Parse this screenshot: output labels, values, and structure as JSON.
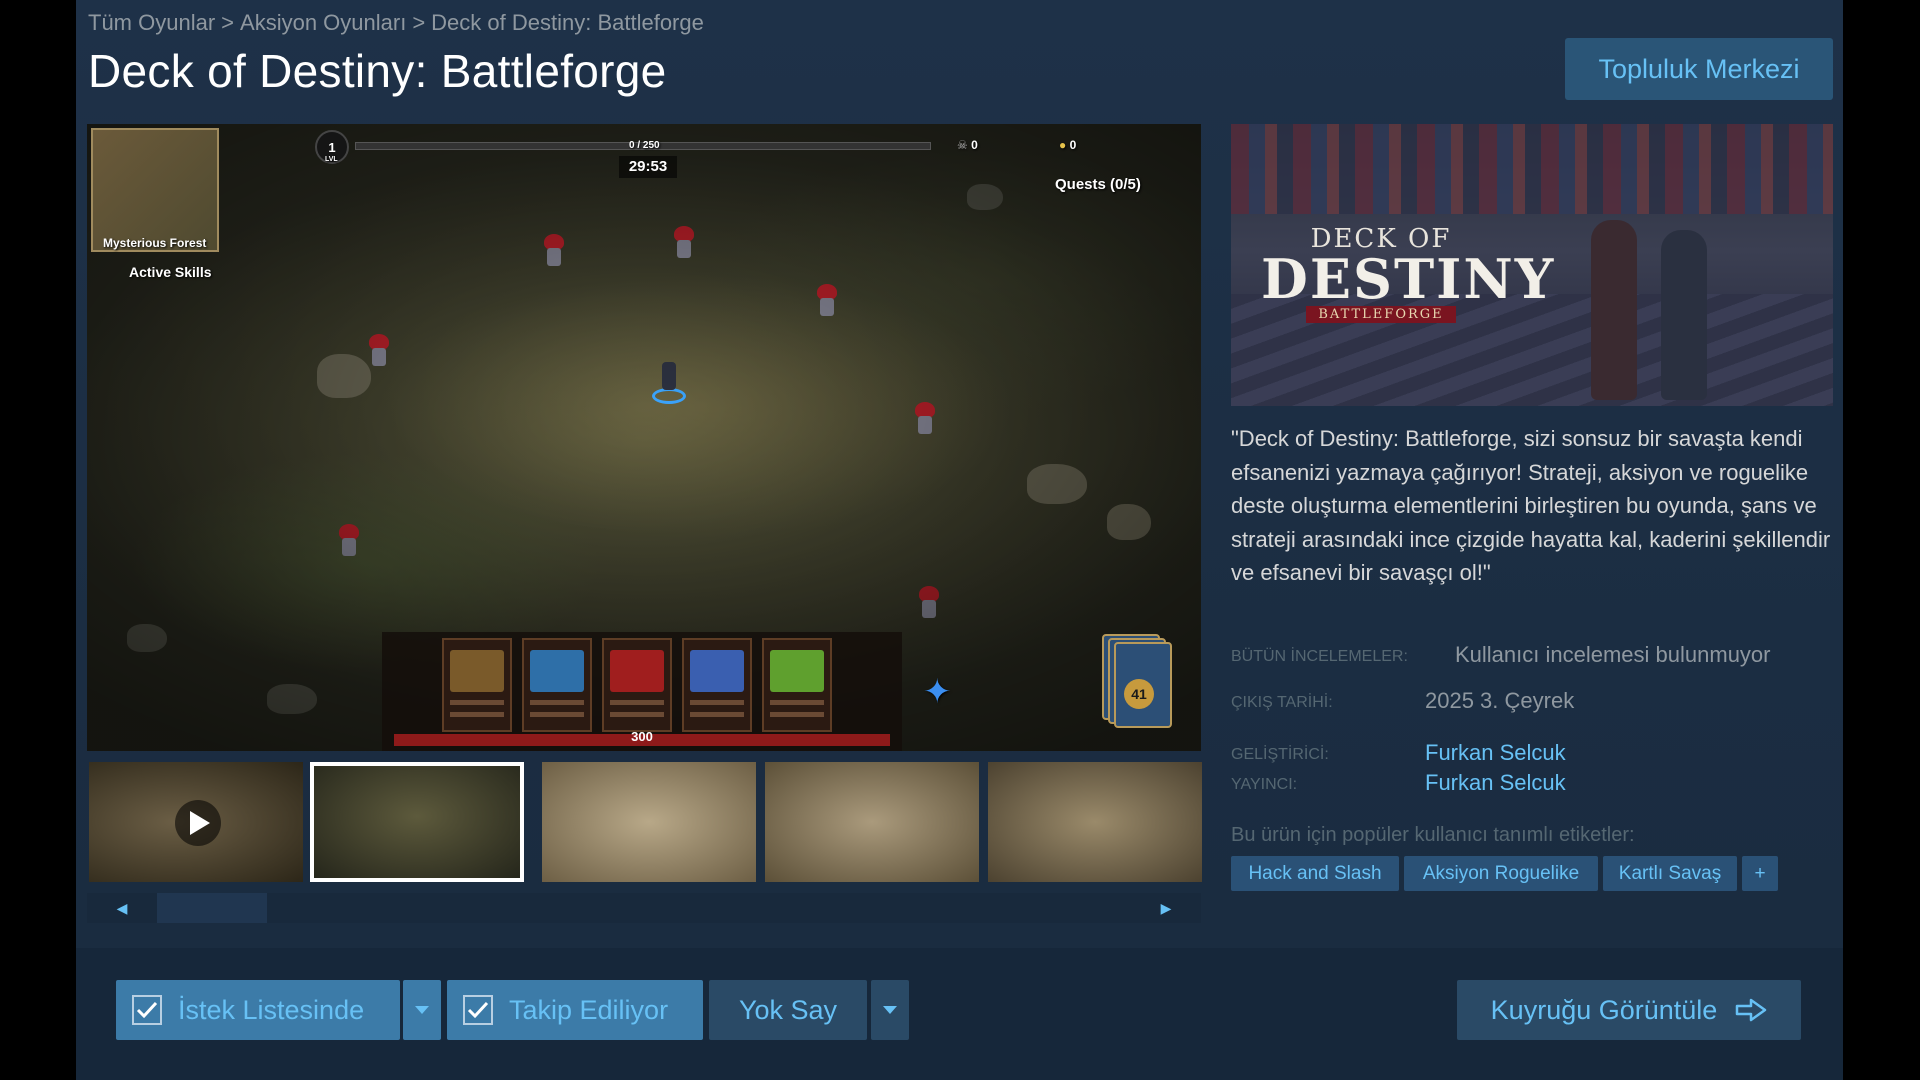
{
  "breadcrumb": {
    "items": [
      "Tüm Oyunlar",
      "Aksiyon Oyunları",
      "Deck of Destiny: Battleforge"
    ],
    "separator": ">"
  },
  "title": "Deck of Destiny: Battleforge",
  "community_button": "Topluluk Merkezi",
  "screenshot": {
    "minimap_label": "Mysterious Forest",
    "active_skills_label": "Active Skills",
    "level": "1",
    "level_sub": "LVL",
    "xp": "0 / 250",
    "timer": "29:53",
    "kills": "0",
    "gold": "0",
    "quests": "Quests (0/5)",
    "health": "300",
    "deck_count": "41",
    "colors": {
      "hp": "#8e1a1a",
      "ring": "#3ba5ff",
      "enemy_hat": "#c0202a"
    }
  },
  "capsule": {
    "logo_top": "DECK OF",
    "logo_main": "DESTINY",
    "logo_sub": "BATTLEFORGE"
  },
  "thumbnails": [
    {
      "type": "video",
      "selected": false
    },
    {
      "type": "image",
      "selected": true
    },
    {
      "type": "image",
      "selected": false
    },
    {
      "type": "image",
      "selected": false
    },
    {
      "type": "image",
      "selected": false
    }
  ],
  "slider": {
    "left_arrow": "◀",
    "right_arrow": "▶"
  },
  "description": "\"Deck of Destiny: Battleforge, sizi sonsuz bir savaşta kendi efsanenizi yazmaya çağırıyor! Strateji, aksiyon ve roguelike deste oluşturma elementlerini birleştiren bu oyunda, şans ve strateji arasındaki ince çizgide hayatta kal, kaderini şekillendir ve efsanevi bir savaşçı ol!\"",
  "meta": {
    "reviews_label": "BÜTÜN İNCELEMELER:",
    "reviews_value": "Kullanıcı incelemesi bulunmuyor",
    "release_label": "ÇIKIŞ TARİHİ:",
    "release_value": "2025 3. Çeyrek",
    "developer_label": "GELİŞTİRİCİ:",
    "developer_value": "Furkan Selcuk",
    "publisher_label": "YAYINCI:",
    "publisher_value": "Furkan Selcuk"
  },
  "tags": {
    "label": "Bu ürün için popüler kullanıcı tanımlı etiketler:",
    "items": [
      "Hack and Slash",
      "Aksiyon Roguelike",
      "Kartlı Savaş"
    ],
    "more": "+"
  },
  "actions": {
    "wishlist": "İstek Listesinde",
    "follow": "Takip Ediliyor",
    "ignore": "Yok Say",
    "dropdown_arrow": "▼",
    "queue": "Kuyruğu Görüntüle"
  },
  "icons": [
    "checkbox-icon",
    "arrow-right-icon",
    "play-icon",
    "chevron-down-icon"
  ]
}
